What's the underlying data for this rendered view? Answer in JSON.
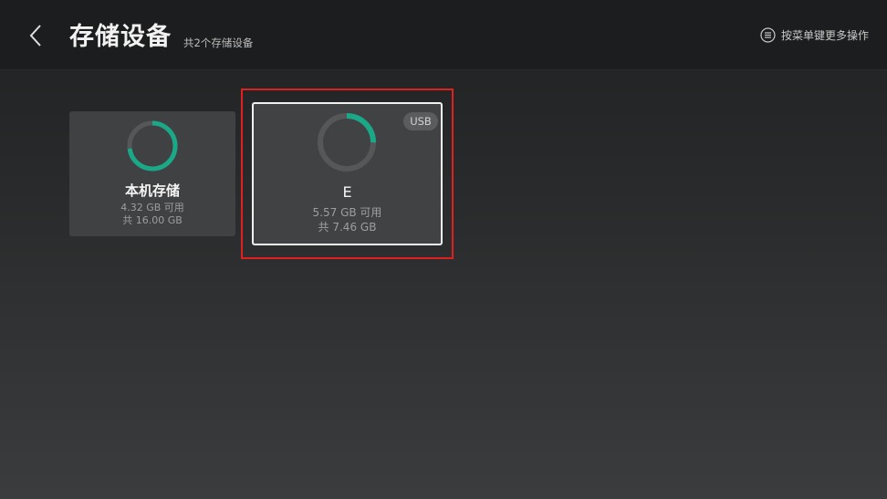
{
  "header": {
    "title": "存储设备",
    "subtitle": "共2个存储设备",
    "hint": "按菜单键更多操作",
    "back_icon": "chevron-left-icon",
    "menu_icon": "menu-circle-icon"
  },
  "devices": [
    {
      "name": "本机存储",
      "available": "4.32 GB 可用",
      "total": "共 16.00 GB",
      "usage_fraction": 0.73,
      "badge": ""
    },
    {
      "name": "E",
      "available": "5.57 GB 可用",
      "total": "共 7.46 GB",
      "usage_fraction": 0.25,
      "badge": "USB"
    }
  ],
  "colors": {
    "ring_used": "#1aa887",
    "ring_track": "#555759",
    "focus_highlight": "#e02020"
  }
}
